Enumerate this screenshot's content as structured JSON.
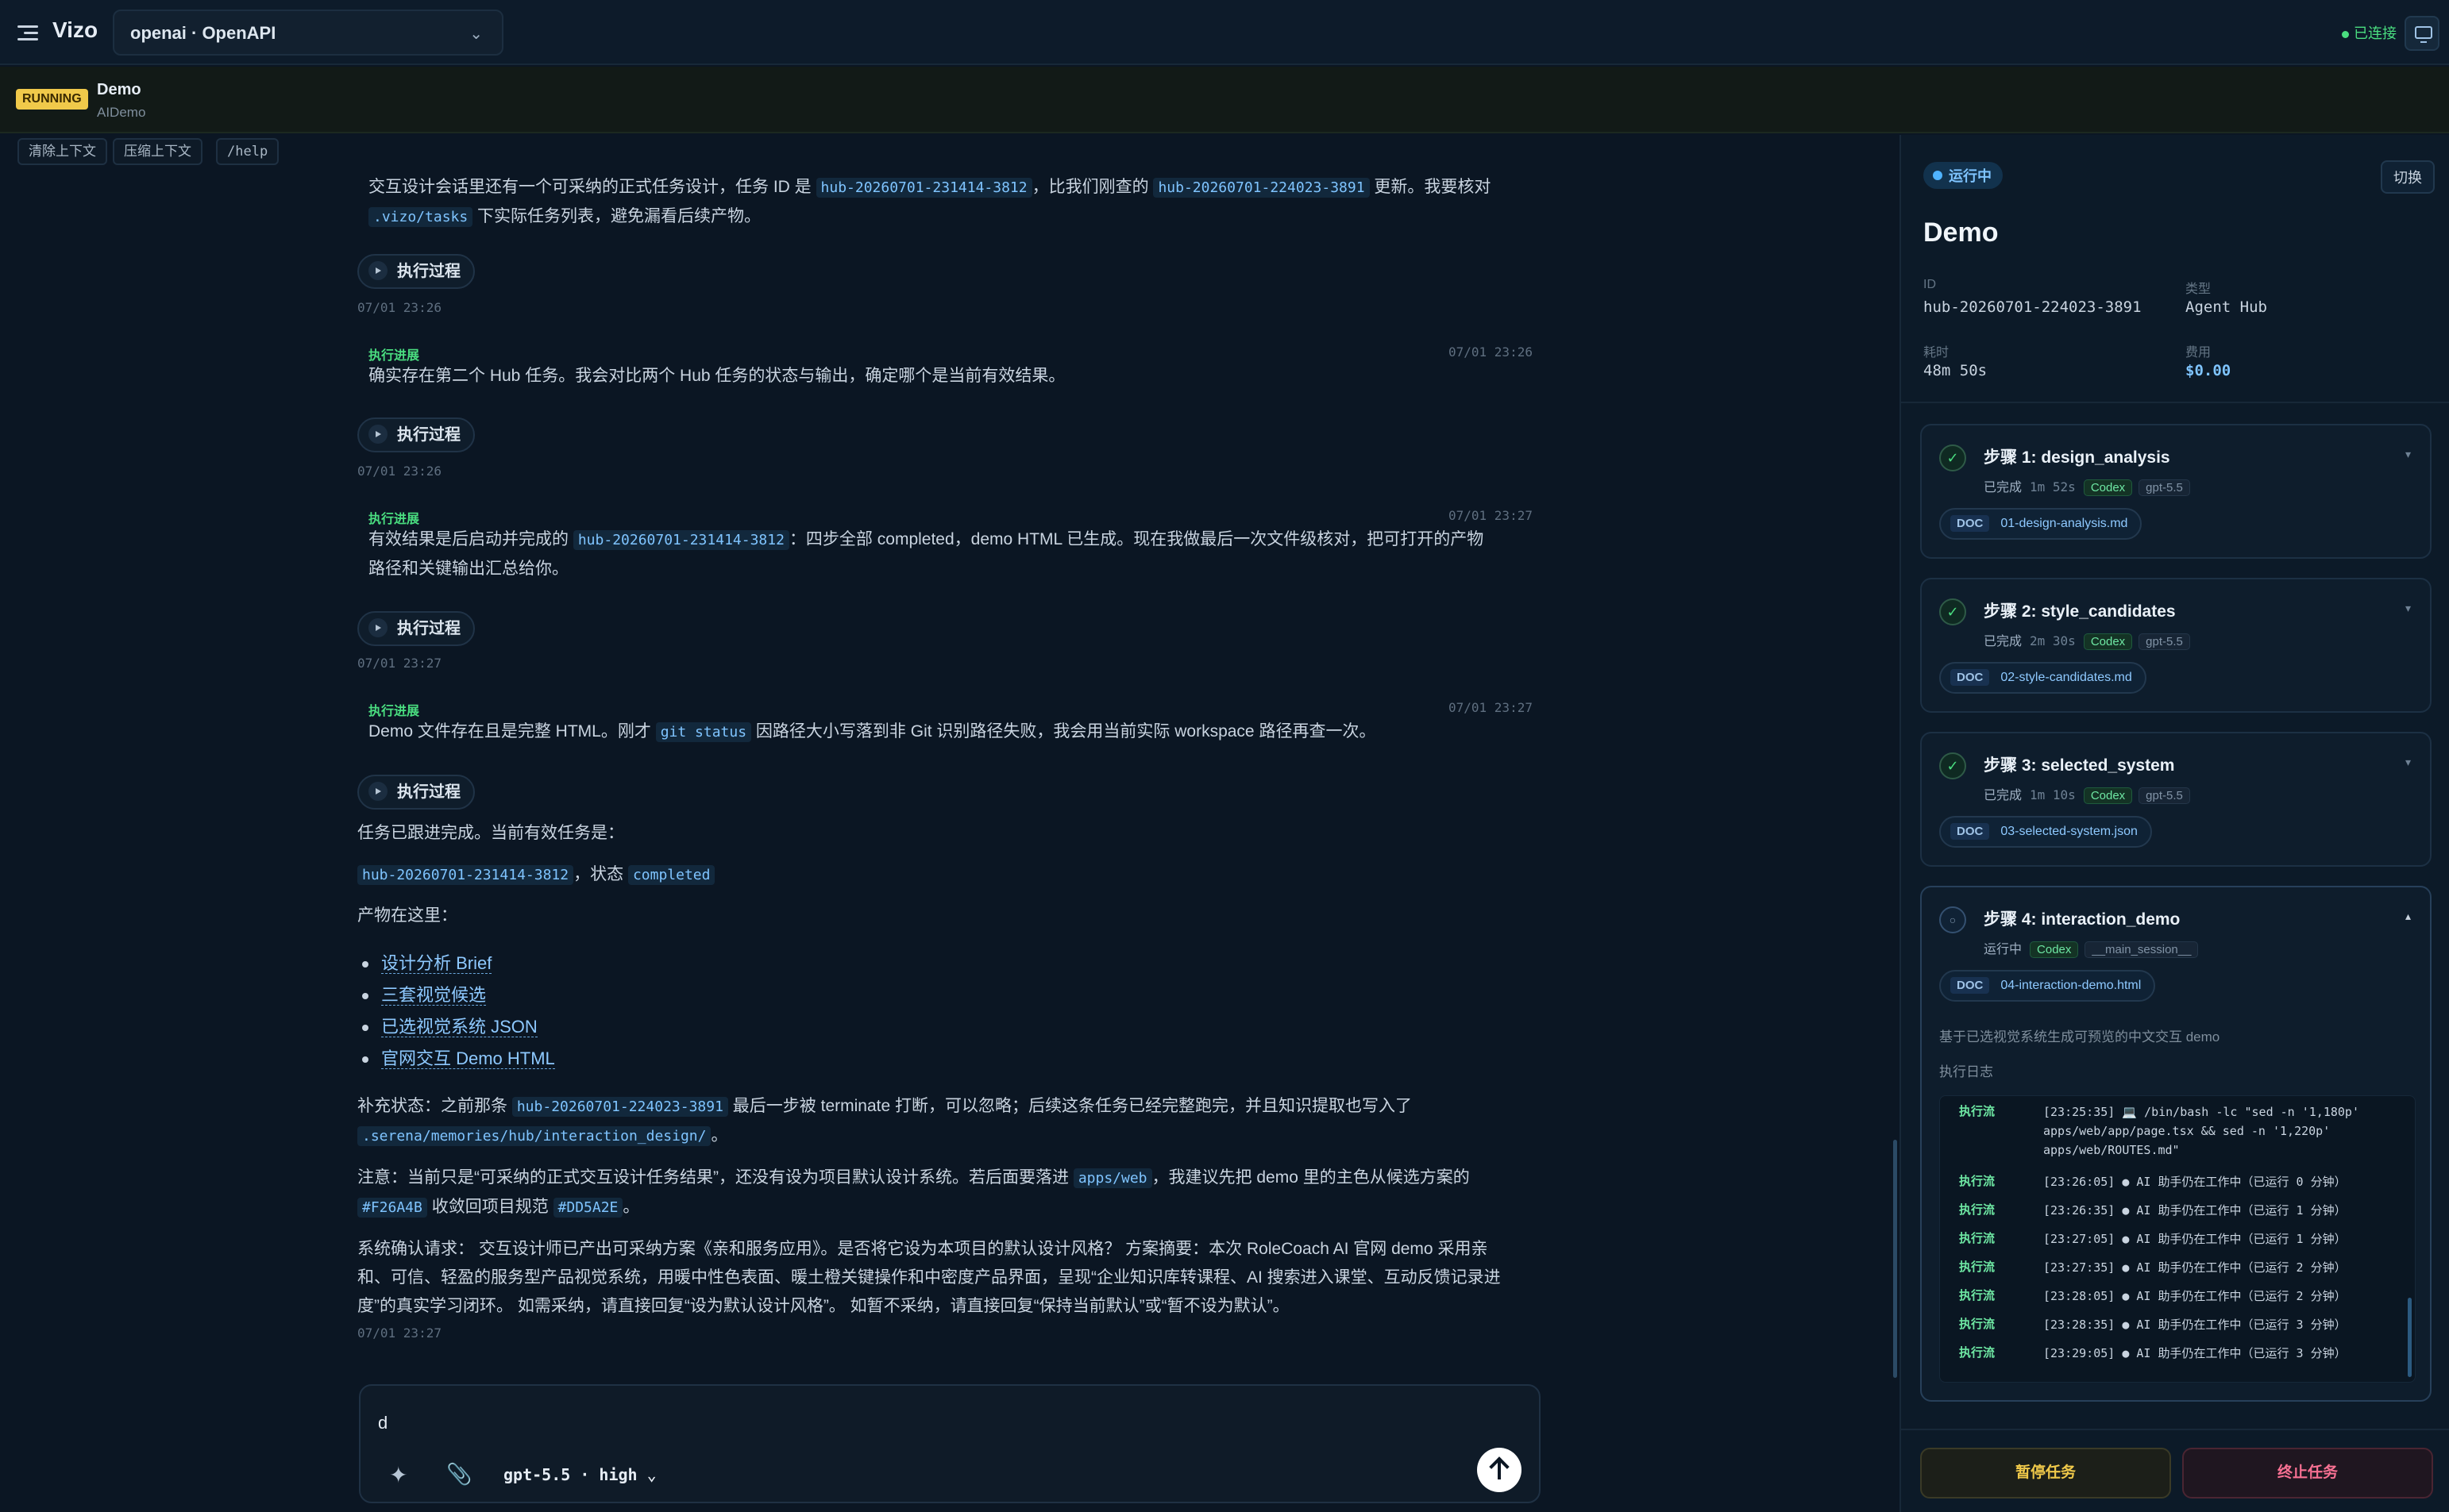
{
  "app": {
    "name": "Vizo",
    "provider": "openai · OpenAPI",
    "connection": "已连接"
  },
  "task": {
    "badge": "RUNNING",
    "title": "Demo",
    "subtitle": "AIDemo"
  },
  "actions": {
    "clear": "清除上下文",
    "compress": "压缩上下文",
    "help": "/help"
  },
  "chat": {
    "p0a": "交互设计会话里还有一个可采纳的正式任务设计，任务 ID 是 ",
    "p0code1": "hub-20260701-231414-3812",
    "p0b": "，比我们刚查的 ",
    "p0code2": "hub-20260701-224023-3891",
    "p0c": " 更新。我要核对",
    "p0code3": ".vizo/tasks",
    "p0d": " 下实际任务列表，避免漏看后续产物。",
    "exec_label": "执行过程",
    "ts1": "07/01 23:26",
    "prog_label": "执行进展",
    "prog1_ts": "07/01 23:26",
    "prog1_text": "确实存在第二个 Hub 任务。我会对比两个 Hub 任务的状态与输出，确定哪个是当前有效结果。",
    "ts2": "07/01 23:26",
    "prog2_ts": "07/01 23:27",
    "prog2_a": "有效结果是后启动并完成的 ",
    "prog2_code": "hub-20260701-231414-3812",
    "prog2_b": "：四步全部 completed，demo HTML 已生成。现在我做最后一次文件级核对，把可打开的产物",
    "prog2_c": "路径和关键输出汇总给你。",
    "ts3": "07/01 23:27",
    "prog3_ts": "07/01 23:27",
    "prog3_a": "Demo 文件存在且是完整 HTML。刚才 ",
    "prog3_code": "git status",
    "prog3_b": " 因路径大小写落到非 Git 识别路径失败，我会用当前实际 workspace 路径再查一次。",
    "done_text": "任务已跟进完成。当前有效任务是：",
    "done_code1": "hub-20260701-231414-3812",
    "done_mid": "，状态 ",
    "done_code2": "completed",
    "outputs_label": "产物在这里：",
    "links": [
      "设计分析 Brief",
      "三套视觉候选",
      "已选视觉系统 JSON",
      "官网交互 Demo HTML"
    ],
    "sup_a": "补充状态：之前那条 ",
    "sup_code": "hub-20260701-224023-3891",
    "sup_b": " 最后一步被 terminate 打断，可以忽略；后续这条任务已经完整跑完，并且知识提取也写入了",
    "sup_code2": ".serena/memories/hub/interaction_design/",
    "sup_c": "。",
    "note_a": "注意：当前只是“可采纳的正式交互设计任务结果”，还没有设为项目默认设计系统。若后面要落进 ",
    "note_code": "apps/web",
    "note_b": "，我建议先把 demo 里的主色从候选方案的",
    "note_code2": "#F26A4B",
    "note_c": " 收敛回项目规范 ",
    "note_code3": "#DD5A2E",
    "note_d": "。",
    "sys_l1": "系统确认请求： 交互设计师已产出可采纳方案《亲和服务应用》。是否将它设为本项目的默认设计风格？ 方案摘要：本次 RoleCoach AI 官网 demo 采用亲",
    "sys_l2": "和、可信、轻盈的服务型产品视觉系统，用暖中性色表面、暖土橙关键操作和中密度产品界面，呈现“企业知识库转课程、AI 搜索进入课堂、互动反馈记录进",
    "sys_l3": "度”的真实学习闭环。 如需采纳，请直接回复“设为默认设计风格”。 如暂不采纳，请直接回复“保持当前默认”或“暂不设为默认”。",
    "ts_last": "07/01 23:27"
  },
  "composer": {
    "value": "d",
    "model": "gpt-5.5 · high",
    "model_chev": "⌄"
  },
  "side": {
    "status": "运行中",
    "switch": "切换",
    "title": "Demo",
    "id_label": "ID",
    "id_value": "hub-20260701-224023-3891",
    "type_label": "类型",
    "type_value": "Agent Hub",
    "time_label": "耗时",
    "time_value": "48m 50s",
    "cost_label": "费用",
    "cost_value": "$0.00",
    "steps": [
      {
        "title": "步骤 1: design_analysis",
        "state": "已完成",
        "dur": "1m 52s",
        "tag1": "Codex",
        "tag2": "gpt-5.5",
        "doc": "01-design-analysis.md"
      },
      {
        "title": "步骤 2: style_candidates",
        "state": "已完成",
        "dur": "2m 30s",
        "tag1": "Codex",
        "tag2": "gpt-5.5",
        "doc": "02-style-candidates.md"
      },
      {
        "title": "步骤 3: selected_system",
        "state": "已完成",
        "dur": "1m 10s",
        "tag1": "Codex",
        "tag2": "gpt-5.5",
        "doc": "03-selected-system.json"
      },
      {
        "title": "步骤 4: interaction_demo",
        "state": "运行中",
        "tag1": "Codex",
        "tag2": "__main_session__",
        "doc": "04-interaction-demo.html",
        "desc": "基于已选视觉系统生成可预览的中文交互 demo",
        "log_label": "执行日志"
      }
    ],
    "doc_tag": "DOC",
    "log": [
      {
        "tag": "执行流",
        "msg": "[23:25:35] 💻 /bin/bash -lc \"sed -n '1,180p' apps/web/app/page.tsx && sed -n '1,220p' apps/web/ROUTES.md\""
      },
      {
        "tag": "执行流",
        "msg": "[23:26:05] ● AI 助手仍在工作中（已运行 0 分钟）"
      },
      {
        "tag": "执行流",
        "msg": "[23:26:35] ● AI 助手仍在工作中（已运行 1 分钟）"
      },
      {
        "tag": "执行流",
        "msg": "[23:27:05] ● AI 助手仍在工作中（已运行 1 分钟）"
      },
      {
        "tag": "执行流",
        "msg": "[23:27:35] ● AI 助手仍在工作中（已运行 2 分钟）"
      },
      {
        "tag": "执行流",
        "msg": "[23:28:05] ● AI 助手仍在工作中（已运行 2 分钟）"
      },
      {
        "tag": "执行流",
        "msg": "[23:28:35] ● AI 助手仍在工作中（已运行 3 分钟）"
      },
      {
        "tag": "执行流",
        "msg": "[23:29:05] ● AI 助手仍在工作中（已运行 3 分钟）"
      }
    ],
    "pause": "暂停任务",
    "stop": "终止任务"
  }
}
